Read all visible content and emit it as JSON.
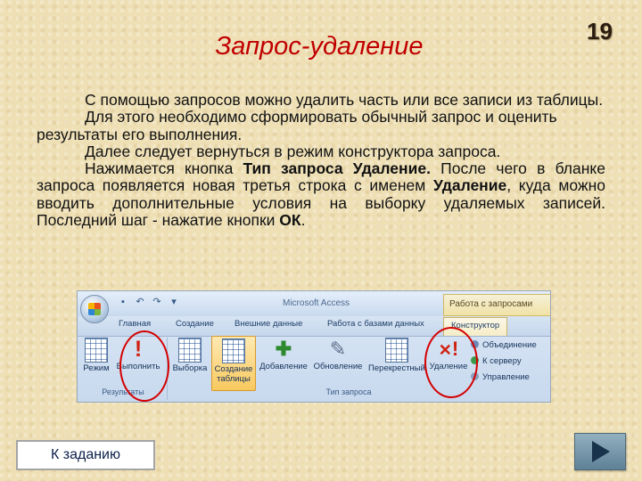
{
  "slide": {
    "number": "19",
    "title": "Запрос-удаление"
  },
  "paragraphs": [
    [
      "С помощью запросов можно удалить часть или все записи из таблицы."
    ],
    [
      "Для этого необходимо сформировать обычный запрос и оценить результаты его выполнения."
    ],
    [
      "Далее следует вернуться в режим конструктора запроса."
    ],
    [
      "Нажимается кнопка ",
      "Тип запроса Удаление.",
      " После чего в бланке запроса появляется новая третья строка с именем ",
      "Удаление",
      ", куда можно вводить дополнительные условия на выборку удаляемых записей. Последний шаг - нажатие кнопки ",
      "ОК",
      "."
    ]
  ],
  "ribbon": {
    "app_title": "Microsoft Access",
    "contextual_tab": "Работа с запросами",
    "quick_access": [
      "save-icon",
      "undo-icon",
      "redo-icon",
      "dropdown-icon"
    ],
    "tabs": [
      "Главная",
      "Создание",
      "Внешние данные",
      "Работа с базами данных",
      "Конструктор"
    ],
    "active_tab": "Конструктор",
    "results_group": {
      "label": "Результаты",
      "commands": [
        "Режим",
        "Выполнить"
      ]
    },
    "query_type_group": {
      "label": "Тип запроса",
      "commands": [
        "Выборка",
        "Создание таблицы",
        "Добавление",
        "Обновление",
        "Перекрестный",
        "Удаление"
      ]
    },
    "side_commands": [
      "Объединение",
      "К серверу",
      "Управление"
    ]
  },
  "buttons": {
    "to_task": "К заданию",
    "next": "next-arrow-icon"
  },
  "colors": {
    "title": "#c00000",
    "highlight_circle": "#d40000",
    "background": "#eedfb4"
  }
}
